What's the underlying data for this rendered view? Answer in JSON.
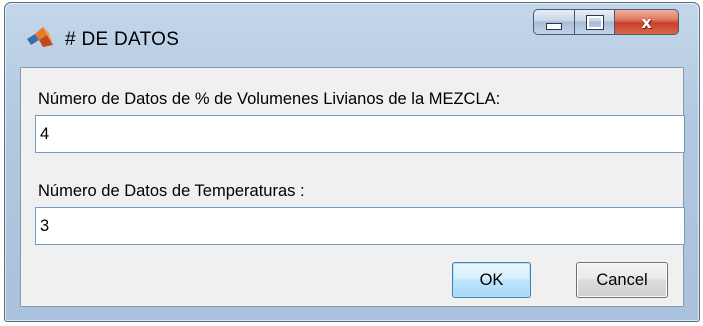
{
  "window": {
    "title": "# DE DATOS"
  },
  "icons": {
    "app": "matlab-logo-icon",
    "minimize": "minimize-icon",
    "maximize": "maximize-icon",
    "close": "close-icon"
  },
  "caption": {
    "close_glyph": "x"
  },
  "form": {
    "field1": {
      "label": "Número de Datos de % de Volumenes Livianos de la MEZCLA:",
      "value": "4"
    },
    "field2": {
      "label": "Número de Datos de Temperaturas :",
      "value": "3"
    }
  },
  "buttons": {
    "ok_label": "OK",
    "cancel_label": "Cancel"
  },
  "colors": {
    "titlebar": "#b2c8e0",
    "client": "#f0f0f0",
    "close_button": "#c8402a",
    "ok_border": "#3c7fb1"
  }
}
